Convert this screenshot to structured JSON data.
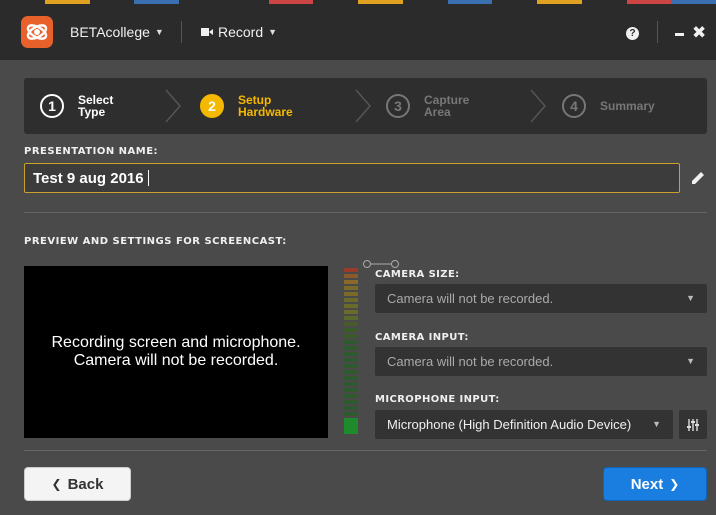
{
  "app": {
    "account_menu": "BETAcollege",
    "record_menu": "Record",
    "help_icon": "?"
  },
  "wizard": {
    "steps": [
      {
        "num": "1",
        "label": "Select Type",
        "state": "done"
      },
      {
        "num": "2",
        "label": "Setup Hardware",
        "state": "active"
      },
      {
        "num": "3",
        "label": "Capture Area",
        "state": "upcoming"
      },
      {
        "num": "4",
        "label": "Summary",
        "state": "upcoming"
      }
    ]
  },
  "presentation": {
    "label": "PRESENTATION NAME:",
    "value": "Test 9 aug 2016"
  },
  "preview": {
    "label": "PREVIEW AND SETTINGS FOR SCREENCAST:",
    "message_line1": "Recording screen and microphone.",
    "message_line2": "Camera will not be recorded."
  },
  "settings": {
    "camera_size_label": "CAMERA SIZE:",
    "camera_size_value": "Camera will not be recorded.",
    "camera_input_label": "CAMERA INPUT:",
    "camera_input_value": "Camera will not be recorded.",
    "microphone_input_label": "MICROPHONE INPUT:",
    "microphone_input_value": "Microphone (High Definition Audio Device)"
  },
  "footer": {
    "back_label": "Back",
    "next_label": "Next"
  },
  "colors": {
    "accent_active": "#f5b800",
    "primary_button": "#1a7ee0",
    "logo": "#e9612a"
  },
  "icons": [
    "logo-icon",
    "video-camera-icon",
    "help-icon",
    "minimize-icon",
    "close-icon",
    "pencil-icon",
    "mixer-icon",
    "chevron-left-icon",
    "chevron-right-icon"
  ]
}
